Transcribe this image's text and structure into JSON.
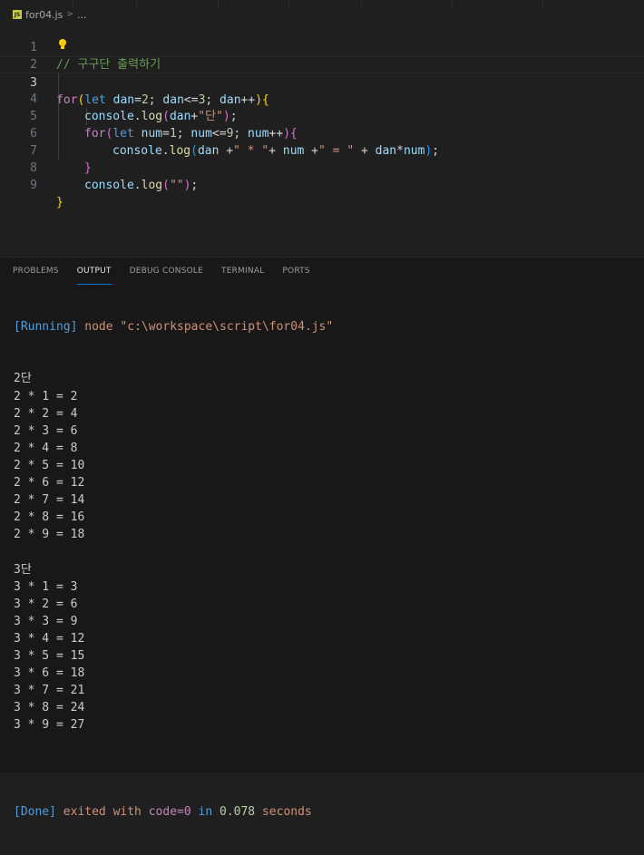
{
  "tab": {
    "filename": "for04.js",
    "breadcrumb_sep": ">",
    "breadcrumb_more": "..."
  },
  "editor": {
    "line_numbers": [
      "1",
      "2",
      "3",
      "4",
      "5",
      "6",
      "7",
      "8",
      "9"
    ],
    "comment": "// 구구단 출력하기",
    "lines": {
      "l3": [
        "for",
        "(",
        "let",
        " dan",
        "=",
        "2",
        "; ",
        "dan",
        "<=",
        "3",
        "; ",
        "dan",
        "++",
        ")",
        "{"
      ],
      "l4": [
        "console",
        ".",
        "log",
        "(",
        "dan",
        "+",
        "\"단\"",
        ")",
        ";"
      ],
      "l5": [
        "for",
        "(",
        "let",
        " num",
        "=",
        "1",
        "; ",
        "num",
        "<=",
        "9",
        "; ",
        "num",
        "++",
        ")",
        "{"
      ],
      "l6": [
        "console",
        ".",
        "log",
        "(",
        "dan",
        " +",
        "\" * \"",
        "+ ",
        "num",
        " +",
        "\" = \"",
        " + ",
        "dan",
        "*",
        "num",
        ")",
        ";"
      ],
      "l7": [
        "}"
      ],
      "l8": [
        "console",
        ".",
        "log",
        "(",
        "\"\"",
        ")",
        ";"
      ],
      "l9": [
        "}"
      ]
    }
  },
  "panel": {
    "tabs": [
      "PROBLEMS",
      "OUTPUT",
      "DEBUG CONSOLE",
      "TERMINAL",
      "PORTS"
    ],
    "active_tab": "OUTPUT",
    "running_tag": "[Running]",
    "running_cmd": " node \"c:\\workspace\\script\\for04.js\"",
    "output_lines": [
      "2단",
      "2 * 1 = 2",
      "2 * 2 = 4",
      "2 * 3 = 6",
      "2 * 4 = 8",
      "2 * 5 = 10",
      "2 * 6 = 12",
      "2 * 7 = 14",
      "2 * 8 = 16",
      "2 * 9 = 18",
      "",
      "3단",
      "3 * 1 = 3",
      "3 * 2 = 6",
      "3 * 3 = 9",
      "3 * 4 = 12",
      "3 * 5 = 15",
      "3 * 6 = 18",
      "3 * 7 = 21",
      "3 * 8 = 24",
      "3 * 9 = 27",
      "",
      ""
    ],
    "done_tag": "[Done]",
    "done_exited": " exited with ",
    "done_code": "code=0",
    "done_in": " in ",
    "done_secs": "0.078",
    "done_seconds": " seconds"
  },
  "colors": {
    "bg": "#1f1f1f",
    "panel_bg": "#181818",
    "accent": "#0078d4"
  }
}
